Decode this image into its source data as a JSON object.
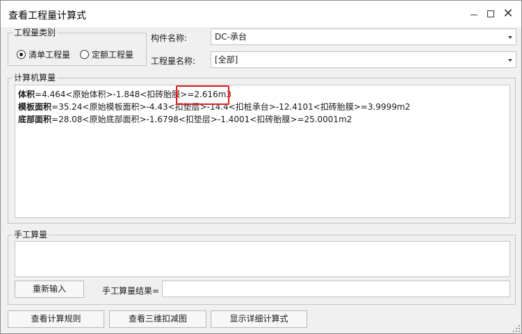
{
  "window": {
    "title": "查看工程量计算式",
    "minimize_glyph": "—",
    "maximize_glyph": "□",
    "close_glyph": "✕"
  },
  "quantity_type": {
    "legend": "工程量类别",
    "options": [
      {
        "label": "清单工程量",
        "checked": true
      },
      {
        "label": "定额工程量",
        "checked": false
      }
    ]
  },
  "component": {
    "label": "构件名称:",
    "value": "DC-承台"
  },
  "quantity_name": {
    "label": "工程量名称:",
    "value": "[全部]"
  },
  "computer_calc": {
    "legend": "计算机算量",
    "lines": [
      {
        "name": "体积",
        "expr": "=4.464<原始体积>-1.848<扣砖胎膜>=2.616m3"
      },
      {
        "name": "模板面积",
        "expr": "=35.24<原始模板面积>-4.43<扣垫层>-14.4<扣桩承台>-12.4101<扣砖胎膜>=3.9999m2"
      },
      {
        "name": "底部面积",
        "expr": "=28.08<原始底部面积>-1.6798<扣垫层>-1.4001<扣砖胎膜>=25.0001m2"
      }
    ]
  },
  "manual_calc": {
    "legend": "手工算量",
    "reinput_button": "重新输入",
    "result_label": "手工算量结果=",
    "result_value": ""
  },
  "footer": {
    "view_rules_button": "查看计算规则",
    "view_3d_button": "查看三维扣减图",
    "show_detail_button": "显示详细计算式"
  },
  "colors": {
    "highlight": "#e02020"
  },
  "icons": {
    "combo_arrow": "chevron-down-icon",
    "radio": "radio-icon"
  }
}
